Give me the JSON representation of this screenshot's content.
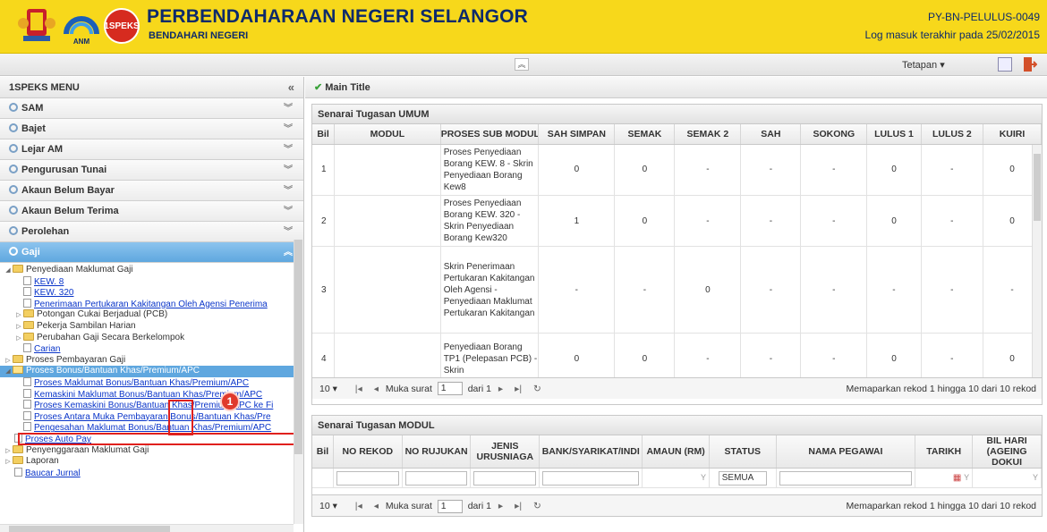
{
  "header": {
    "title": "PERBENDAHARAAN NEGERI SELANGOR",
    "subtitle": "BENDAHARI NEGERI",
    "user_id": "PY-BN-PELULUS-0049",
    "last_login": "Log masuk terakhir pada 25/02/2015",
    "logo_anm_text": "ANM",
    "logo_speks_text": "1SPEKS"
  },
  "toolbar": {
    "settings_label": "Tetapan ▾"
  },
  "sidebar": {
    "title": "1SPEKS MENU",
    "sections": [
      {
        "label": "SAM"
      },
      {
        "label": "Bajet"
      },
      {
        "label": "Lejar AM"
      },
      {
        "label": "Pengurusan Tunai"
      },
      {
        "label": "Akaun Belum Bayar"
      },
      {
        "label": "Akaun Belum Terima"
      },
      {
        "label": "Perolehan"
      },
      {
        "label": "Gaji"
      }
    ],
    "tree": [
      "Penyediaan Maklumat Gaji",
      "KEW. 8",
      "KEW. 320",
      "Penerimaan Pertukaran Kakitangan Oleh Agensi Penerima",
      "Potongan Cukai Berjadual (PCB)",
      "Pekerja Sambilan Harian",
      "Perubahan Gaji Secara Berkelompok",
      "Carian",
      "Proses Pembayaran Gaji",
      "Proses Bonus/Bantuan Khas/Premium/APC",
      "Proses Maklumat Bonus/Bantuan Khas/Premium/APC",
      "Kemaskini Maklumat Bonus/Bantuan Khas/Premium/APC",
      "Proses Kemaskini Bonus/Bantuan Khas/Premium/APC ke Fi",
      "Proses Antara Muka Pembayaran Bonus/Bantuan Khas/Pre",
      "Pengesahan Maklumat Bonus/Bantuan Khas/Premium/APC",
      "Proses Auto Pay",
      "Penyenggaraan Maklumat Gaji",
      "Laporan",
      "Baucar Jurnal"
    ],
    "badge": "1"
  },
  "main": {
    "crumb": "Main Title",
    "umum": {
      "title": "Senarai Tugasan UMUM",
      "columns": [
        "Bil",
        "MODUL",
        "PROSES SUB MODUL",
        "SAH SIMPAN",
        "SEMAK",
        "SEMAK 2",
        "SAH",
        "SOKONG",
        "LULUS 1",
        "LULUS 2",
        "KUIRI"
      ],
      "rows": [
        {
          "bil": "1",
          "modul": "",
          "proses": "Proses Penyediaan Borang KEW. 8 - Skrin Penyediaan Borang Kew8",
          "sah_simpan": "0",
          "semak": "0",
          "semak2": "-",
          "sah": "-",
          "sokong": "-",
          "lulus1": "0",
          "lulus2": "-",
          "kuiri": "0"
        },
        {
          "bil": "2",
          "modul": "",
          "proses": "Proses Penyediaan Borang KEW. 320 - Skrin Penyediaan Borang Kew320",
          "sah_simpan": "1",
          "semak": "0",
          "semak2": "-",
          "sah": "-",
          "sokong": "-",
          "lulus1": "0",
          "lulus2": "-",
          "kuiri": "0"
        },
        {
          "bil": "3",
          "modul": "",
          "proses": "Skrin Penerimaan Pertukaran Kakitangan Oleh Agensi - Penyediaan Maklumat Pertukaran Kakitangan",
          "sah_simpan": "-",
          "semak": "-",
          "semak2": "0",
          "sah": "-",
          "sokong": "-",
          "lulus1": "-",
          "lulus2": "-",
          "kuiri": "-"
        },
        {
          "bil": "4",
          "modul": "",
          "proses": "Penyediaan Borang TP1 (Pelepasan PCB) - Skrin",
          "sah_simpan": "0",
          "semak": "0",
          "semak2": "-",
          "sah": "-",
          "sokong": "-",
          "lulus1": "0",
          "lulus2": "-",
          "kuiri": "0"
        }
      ],
      "pager": {
        "page_size": "10 ▾",
        "page_label": "Muka surat",
        "page": "1",
        "of_label": "dari 1",
        "info": "Memaparkan rekod 1 hingga 10 dari 10 rekod"
      }
    },
    "modul": {
      "title": "Senarai Tugasan MODUL",
      "columns": [
        "Bil",
        "NO REKOD",
        "NO RUJUKAN",
        "JENIS URUSNIAGA",
        "BANK/SYARIKAT/INDI",
        "AMAUN (RM)",
        "STATUS",
        "NAMA PEGAWAI",
        "TARIKH",
        "BIL HARI (AGEING DOKUI"
      ],
      "status_filter": "SEMUA",
      "pager": {
        "page_size": "10 ▾",
        "page_label": "Muka surat",
        "page": "1",
        "of_label": "dari 1",
        "info": "Memaparkan rekod 1 hingga 10 dari 10 rekod"
      }
    }
  }
}
